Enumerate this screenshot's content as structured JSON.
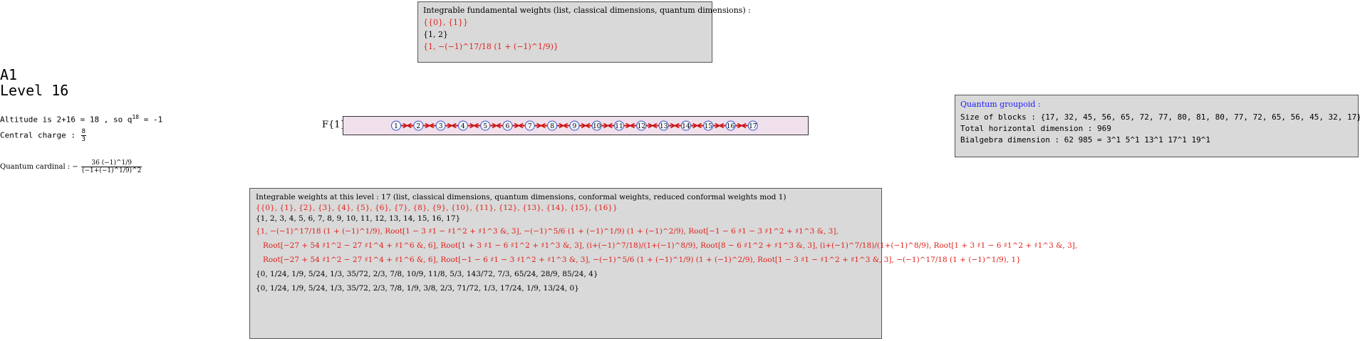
{
  "header": {
    "algebra": "A1",
    "level": "Level 16"
  },
  "info": {
    "altitude_text": "Altitude is 2+16 = 18 , so q",
    "altitude_exp": "18",
    "altitude_tail": " = -1",
    "central_label": "Central charge : ",
    "central_num": "8",
    "central_den": "3",
    "qcard_label": "Quantum cardinal : −",
    "qcard_num": "36 (−1)^1/9",
    "qcard_den": "(−1+(−1)^1/9)^2"
  },
  "fundamental": {
    "title": "Integrable fundamental weights (list, classical dimensions, quantum dimensions) :",
    "list": "{{0}, {1}}",
    "classical": "{1, 2}",
    "quantum": "{1, −(−1)^17/18 (1 + (−1)^1/9)}"
  },
  "graph": {
    "label": "F{1}",
    "nodes": [
      "1",
      "2",
      "3",
      "4",
      "5",
      "6",
      "7",
      "8",
      "9",
      "10",
      "11",
      "12",
      "13",
      "14",
      "15",
      "16",
      "17"
    ],
    "node_color": "#3a5bc7",
    "edge_color": "#cc1a1a"
  },
  "weights": {
    "title": "Integrable weights at this level : 17 (list, classical dimensions, quantum dimensions, conformal weights, reduced conformal weights mod 1)",
    "list": "{{0}, {1}, {2}, {3}, {4}, {5}, {6}, {7}, {8}, {9}, {10}, {11}, {12}, {13}, {14}, {15}, {16}}",
    "classical": "{1, 2, 3, 4, 5, 6, 7, 8, 9, 10, 11, 12, 13, 14, 15, 16, 17}",
    "quantum_1": "{1, −(−1)^17/18 (1 + (−1)^1/9), Root[1 − 3 ♯1 − ♯1^2 + ♯1^3 &, 3], −(−1)^5/6 (1 + (−1)^1/9) (1 + (−1)^2/9), Root[−1 − 6 ♯1 − 3 ♯1^2 + ♯1^3 &, 3],",
    "quantum_2": "Root[−27 + 54 ♯1^2 − 27 ♯1^4 + ♯1^6 &, 6], Root[1 + 3 ♯1 − 6 ♯1^2 + ♯1^3 &, 3], (i+(−1)^7/18)/(1+(−1)^8/9), Root[8 − 6 ♯1^2 + ♯1^3 &, 3], (i+(−1)^7/18)/(1+(−1)^8/9), Root[1 + 3 ♯1 − 6 ♯1^2 + ♯1^3 &, 3],",
    "quantum_3": "Root[−27 + 54 ♯1^2 − 27 ♯1^4 + ♯1^6 &, 6], Root[−1 − 6 ♯1 − 3 ♯1^2 + ♯1^3 &, 3], −(−1)^5/6 (1 + (−1)^1/9) (1 + (−1)^2/9), Root[1 − 3 ♯1 − ♯1^2 + ♯1^3 &, 3], −(−1)^17/18 (1 + (−1)^1/9), 1}",
    "conformal": "{0, 1/24, 1/9, 5/24, 1/3, 35/72, 2/3, 7/8, 10/9, 11/8, 5/3, 143/72, 7/3, 65/24, 28/9, 85/24, 4}",
    "reduced": "{0, 1/24, 1/9, 5/24, 1/3, 35/72, 2/3, 7/8, 1/9, 3/8, 2/3, 71/72, 1/3, 17/24, 1/9, 13/24, 0}"
  },
  "groupoid": {
    "title": "Quantum groupoid :",
    "blocks": "Size of blocks : {17, 32, 45, 56, 65, 72, 77, 80, 81, 80, 77, 72, 65, 56, 45, 32, 17}",
    "horizontal": "Total horizontal dimension : 969",
    "bialgebra": "Bialgebra dimension : 62 985 = 3^1 5^1 13^1 17^1 19^1"
  }
}
